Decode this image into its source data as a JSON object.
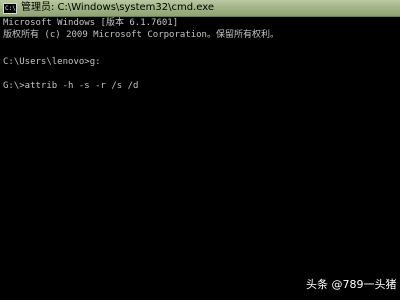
{
  "window": {
    "title": "管理员: C:\\Windows\\system32\\cmd.exe",
    "icon": "cmd-icon"
  },
  "console": {
    "lines": [
      "Microsoft Windows [版本 6.1.7601]",
      "版权所有 (c) 2009 Microsoft Corporation。保留所有权利。",
      "",
      "C:\\Users\\lenovo>g:",
      "",
      "G:\\>attrib -h -s -r /s /d"
    ]
  },
  "watermark": {
    "text": "头条 @789一头猪"
  },
  "colors": {
    "console_background": "#000000",
    "console_text": "#c4c4c4",
    "titlebar": "#9fb283"
  }
}
